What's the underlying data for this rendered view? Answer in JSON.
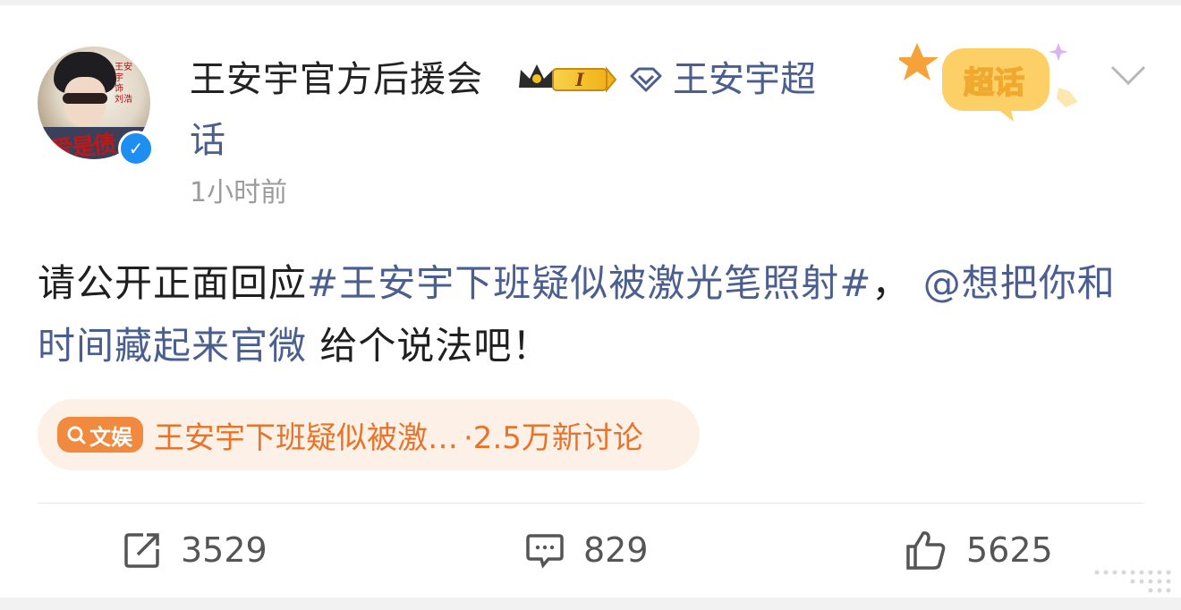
{
  "post": {
    "author": "王安宇官方后援会",
    "level_badge": "I",
    "topic_name": "王安宇超",
    "topic_name_wrap": "话",
    "time": "1小时前",
    "chaohua_badge": "超话",
    "content": {
      "part1": "请公开正面回应",
      "hashtag": "#王安宇下班疑似被激光笔照射#",
      "part2": "， ",
      "mention": "@想把你和时间藏起来官微",
      "part3": " 给个说法吧！"
    },
    "topic_pill": {
      "tag": "文娱",
      "title": "王安宇下班疑似被激…",
      "count": "·2.5万新讨论"
    }
  },
  "actions": {
    "repost": "3529",
    "comment": "829",
    "like": "5625"
  },
  "colors": {
    "link": "#4a5f8f",
    "accent_orange": "#f08a3e",
    "verified_blue": "#1e8ff0"
  },
  "icons": [
    "verified-icon",
    "crown-icon",
    "diamond-icon",
    "chevron-down-icon",
    "search-icon",
    "repost-icon",
    "comment-icon",
    "like-icon",
    "more-dots-icon"
  ]
}
